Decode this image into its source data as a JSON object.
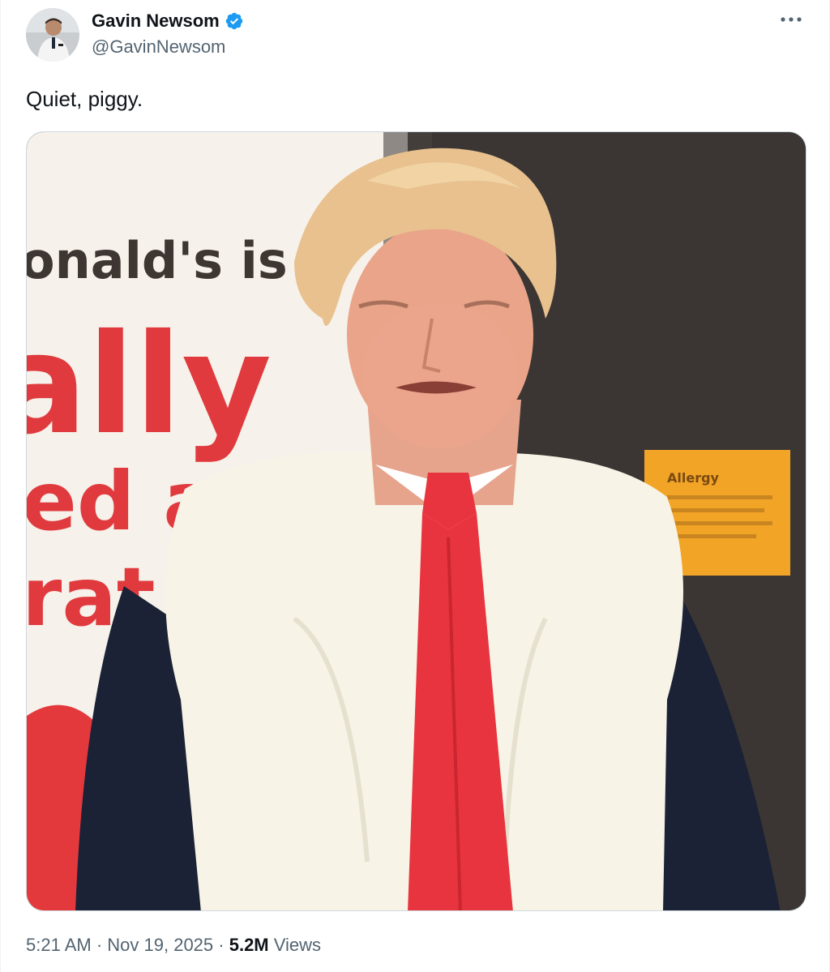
{
  "author": {
    "display_name": "Gavin Newsom",
    "handle": "@GavinNewsom",
    "verified": true,
    "avatar_icon": "avatar-photo"
  },
  "tweet": {
    "text": "Quiet, piggy.",
    "time": "5:21 AM",
    "separator": " · ",
    "date": "Nov 19, 2025",
    "views_count": "5.2M",
    "views_label": " Views"
  },
  "media": {
    "sign_lines": [
      "onald's is",
      "ally",
      "ed a",
      "rat"
    ],
    "notice_text": "Allergy"
  },
  "colors": {
    "verified_badge": "#1d9bf0",
    "secondary_text": "#536471",
    "sign_red": "#e03a3e",
    "tie_red": "#e8343e"
  },
  "icons": {
    "more": "more-horizontal-icon",
    "verified": "verified-badge-icon"
  }
}
